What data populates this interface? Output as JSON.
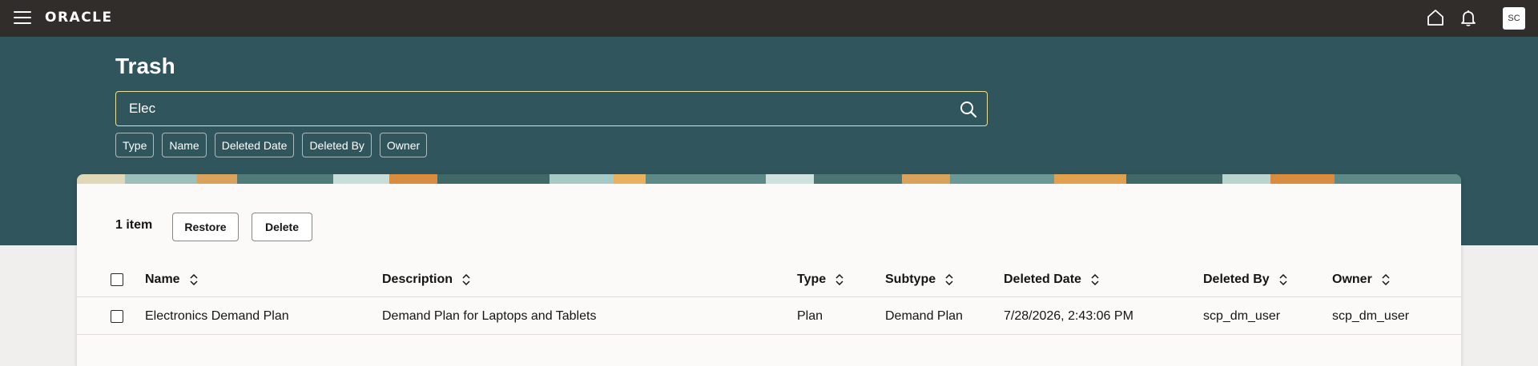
{
  "topbar": {
    "logo": "ORACLE",
    "avatar_initials": "SC"
  },
  "page": {
    "title": "Trash"
  },
  "search": {
    "value": "Elec",
    "placeholder": ""
  },
  "filters": [
    "Type",
    "Name",
    "Deleted Date",
    "Deleted By",
    "Owner"
  ],
  "toolbar": {
    "count_label": "1 item",
    "restore_label": "Restore",
    "delete_label": "Delete"
  },
  "table": {
    "columns": [
      "Name",
      "Description",
      "Type",
      "Subtype",
      "Deleted Date",
      "Deleted By",
      "Owner"
    ],
    "rows": [
      [
        "Electronics Demand Plan",
        "Demand Plan for Laptops and Tablets",
        "Plan",
        "Demand Plan",
        "7/28/2026, 2:43:06 PM",
        "scp_dm_user",
        "scp_dm_user"
      ]
    ]
  },
  "colors": {
    "topbar": "#312d2a",
    "hero": "#30555c",
    "search_border": "#e8e19a",
    "card": "#fbfaf8"
  },
  "icons": [
    "menu-icon",
    "home-icon",
    "bell-icon",
    "search-icon",
    "sort-icon"
  ]
}
